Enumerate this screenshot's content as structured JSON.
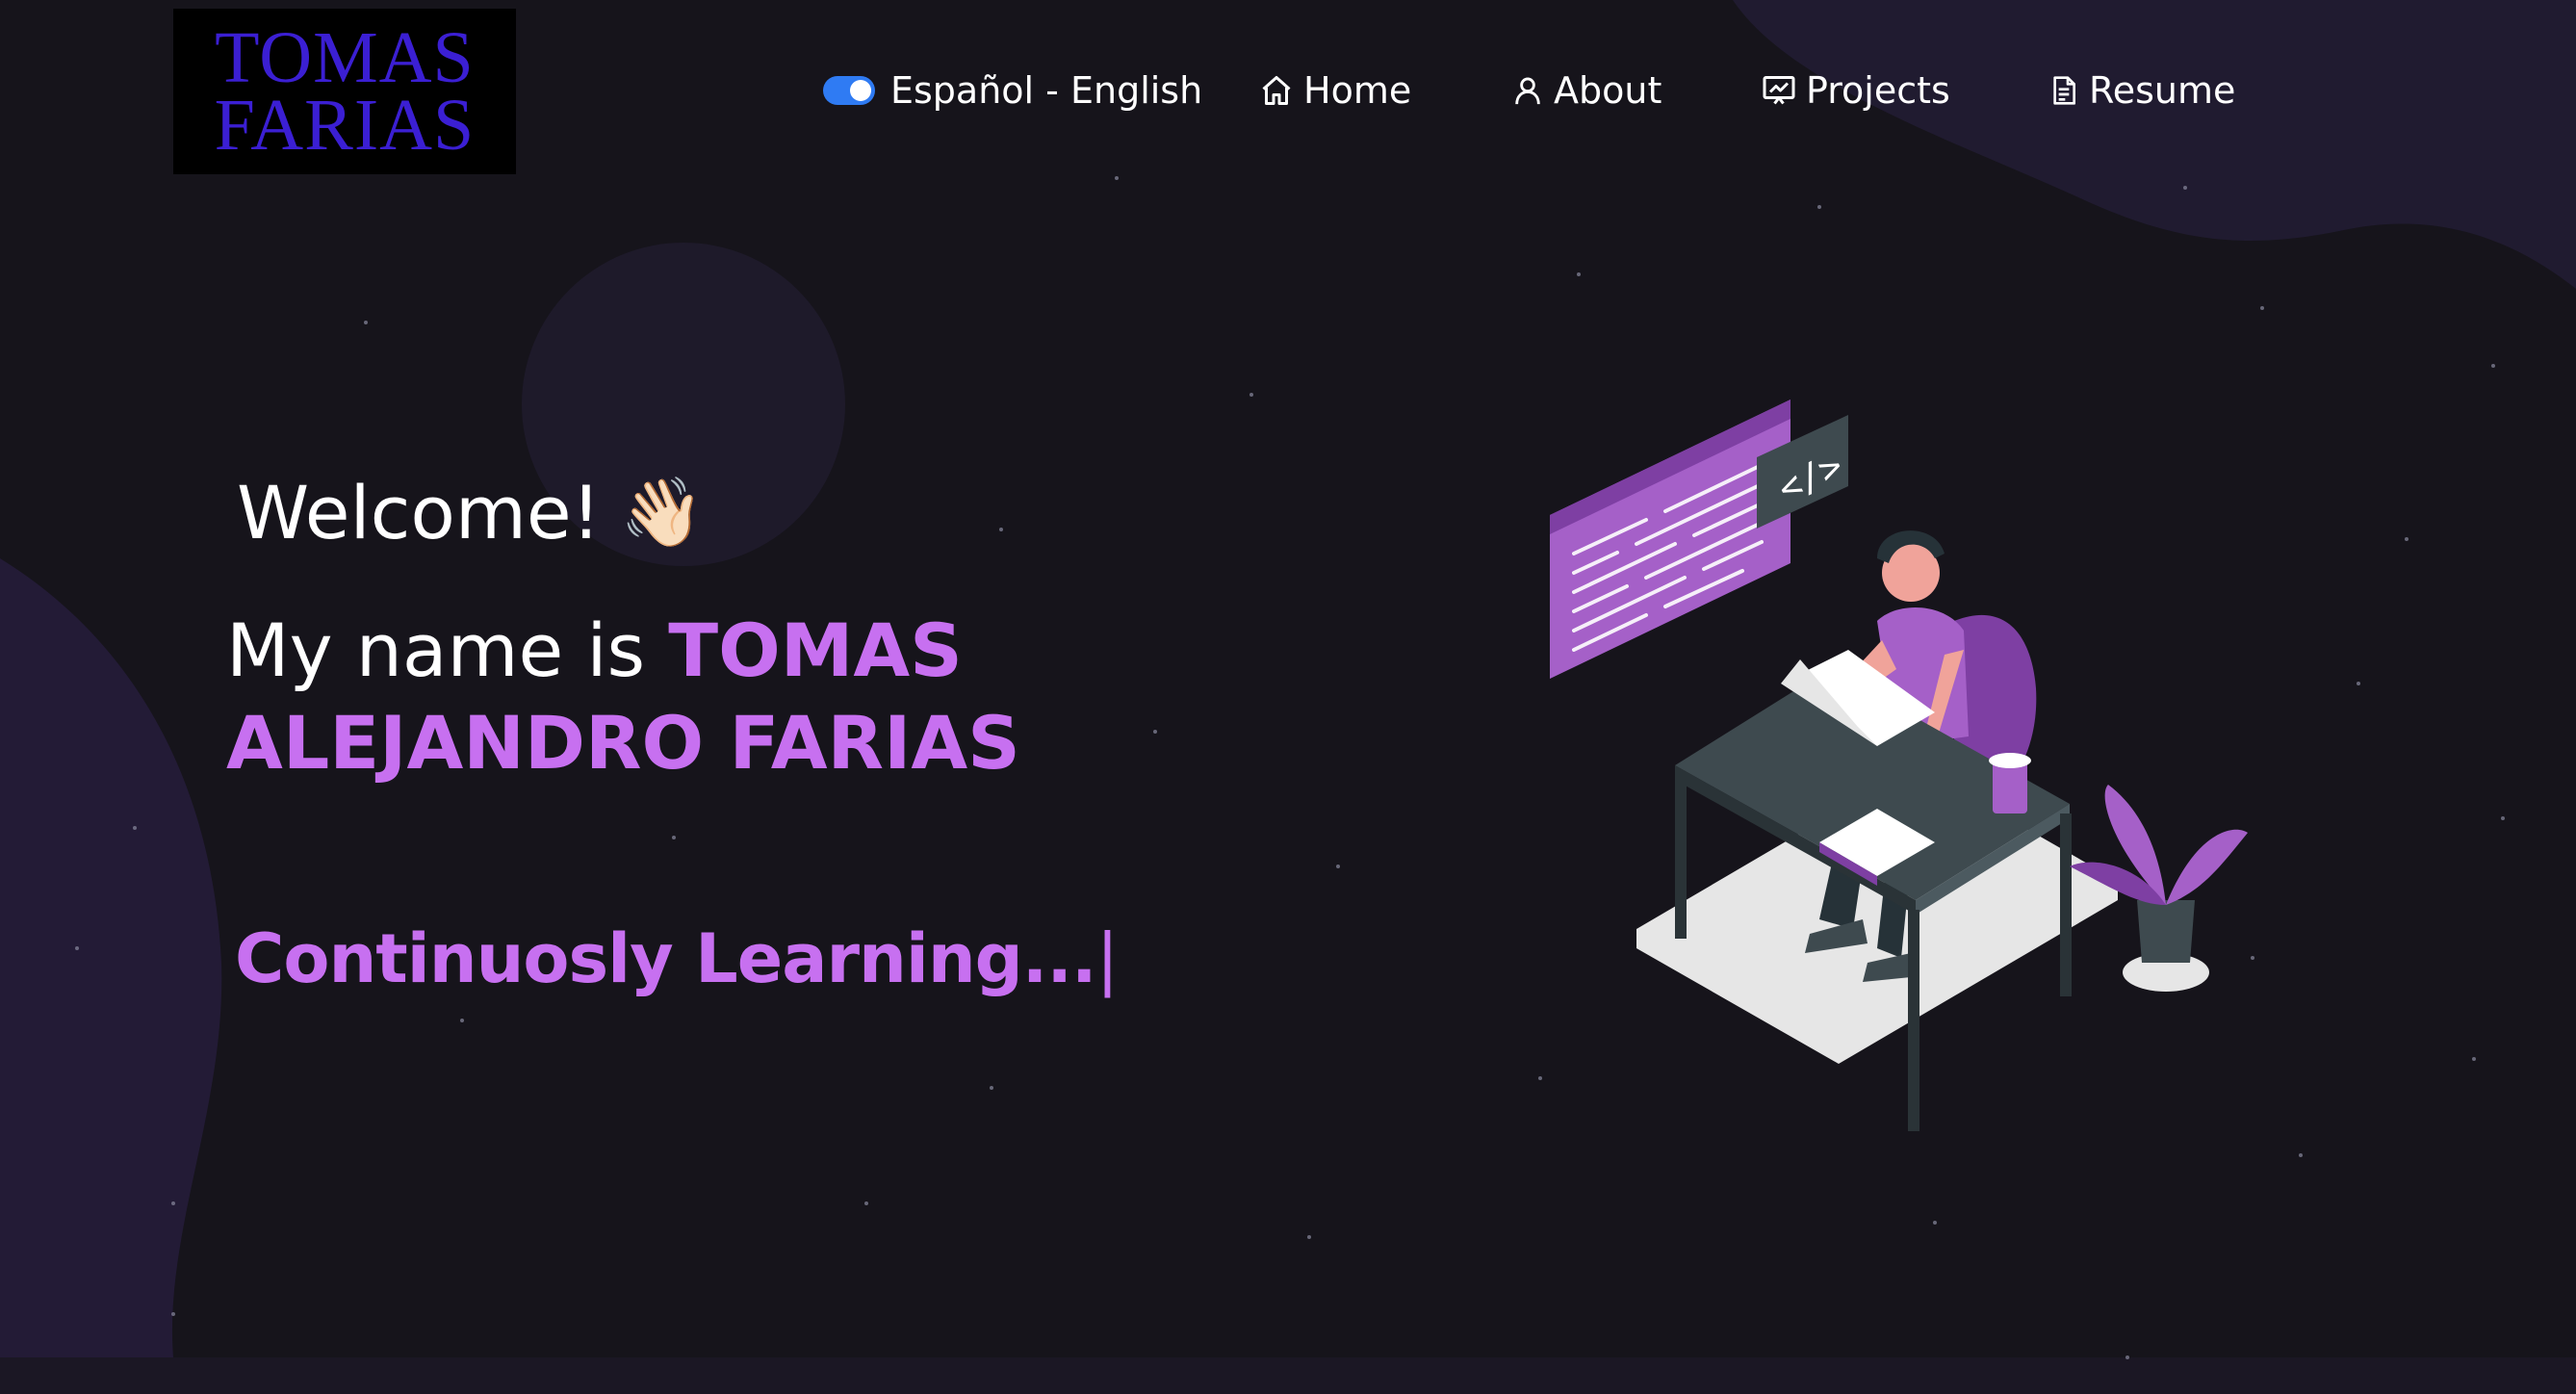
{
  "logo": {
    "line1": "TOMAS",
    "line2": "FARIAS"
  },
  "language_toggle": {
    "label": "Español - English",
    "state": "on"
  },
  "nav": {
    "home": "Home",
    "about": "About",
    "projects": "Projects",
    "resume": "Resume"
  },
  "hero": {
    "welcome": "Welcome!",
    "wave": "👋🏻",
    "name_prefix": "My name is ",
    "name_highlight": "TOMAS ALEJANDRO FARIAS",
    "typing": "Continuosly Learning...",
    "cursor": "|"
  },
  "colors": {
    "background": "#16141b",
    "accent": "#c770f0",
    "logo_text": "#3b1fd3",
    "toggle": "#2f7bf3"
  },
  "icons": [
    "home-icon",
    "user-icon",
    "projects-icon",
    "resume-icon",
    "waving-hand-icon"
  ]
}
